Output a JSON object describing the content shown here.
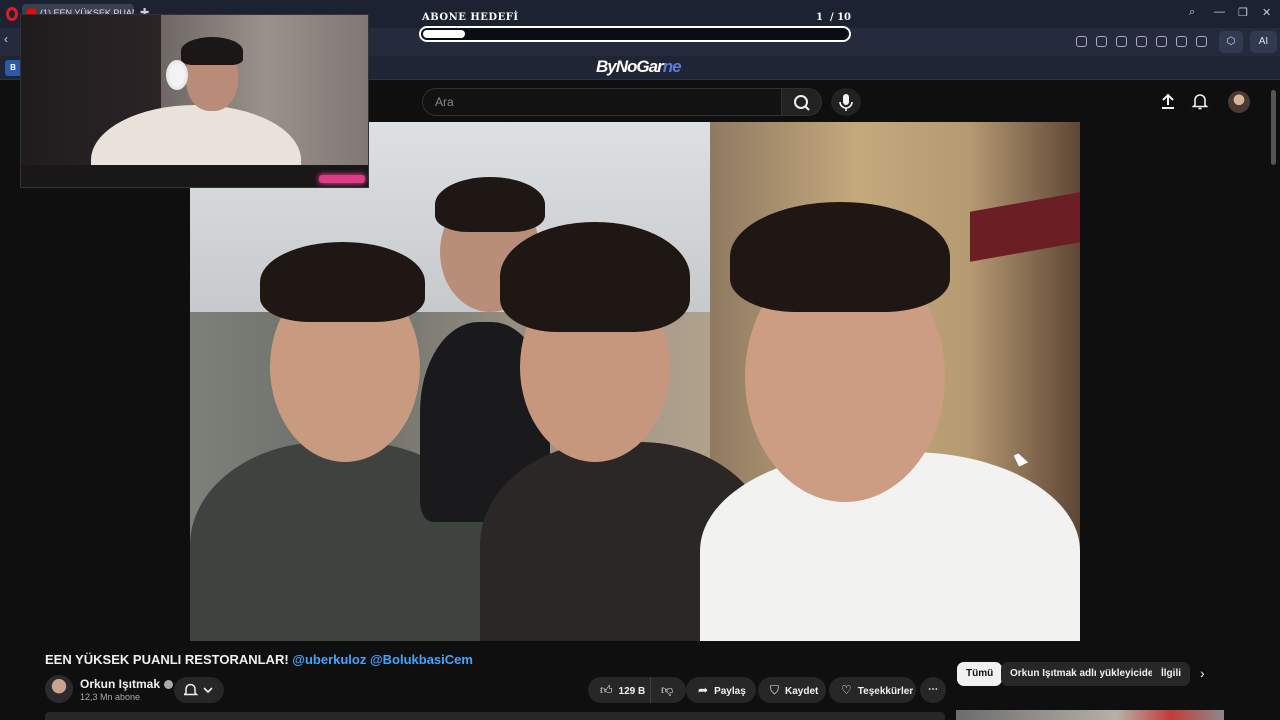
{
  "browser": {
    "tab_title": "(1) EEN YÜKSEK PUANLI...",
    "bookmark_initial": "B",
    "brand_left": "ByNoGar",
    "brand_right": "ne"
  },
  "stream_overlay": {
    "goal_title": "ABONE HEDEFİ",
    "goal_current": "1",
    "goal_target": "/ 10",
    "goal_progress": 0.1
  },
  "youtube_header": {
    "search_placeholder": "Ara"
  },
  "video": {
    "title": "EEN YÜKSEK PUANLI RESTORANLAR!",
    "mentions": "@uberkuloz @BolukbasiCem",
    "channel_name": "Orkun Işıtmak",
    "subscribers": "12,3 Mn abone"
  },
  "actions": {
    "like_count": "129 B",
    "share": "Paylaş",
    "save": "Kaydet",
    "thanks": "Teşekkürler",
    "more": "⋯"
  },
  "chips": {
    "all": "Tümü",
    "uploader": "Orkun Işıtmak adlı yükleyiciden",
    "related": "İlgili"
  },
  "colors": {
    "mention": "#3ea6ff",
    "background": "#0f0f0f",
    "pill": "#272727"
  }
}
